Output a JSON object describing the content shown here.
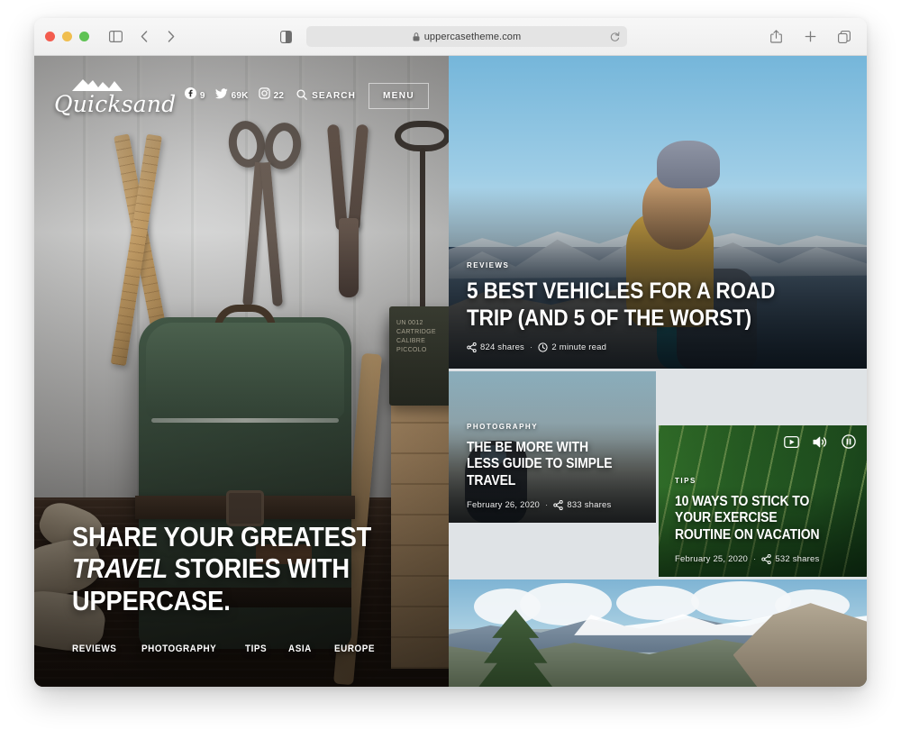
{
  "browser": {
    "url": "uppercasetheme.com",
    "lock_icon": "lock-icon",
    "reload_icon": "reload-icon",
    "sidebar_icon": "sidebar-toggle-icon",
    "back_icon": "back-chevron-icon",
    "forward_icon": "forward-chevron-icon",
    "reader_icon": "reader-appearance-icon",
    "share_icon": "share-icon",
    "newtab_icon": "plus-icon",
    "tabs_icon": "tab-overview-icon",
    "traffic_lights": [
      "close",
      "minimize",
      "zoom"
    ]
  },
  "hero": {
    "brand": "Quicksand",
    "brand_mark": "mountain-icon",
    "social": [
      {
        "network": "facebook",
        "icon": "facebook-icon",
        "count": "9"
      },
      {
        "network": "twitter",
        "icon": "twitter-icon",
        "count": "69K"
      },
      {
        "network": "instagram",
        "icon": "instagram-icon",
        "count": "22"
      }
    ],
    "search_label": "SEARCH",
    "search_icon": "search-icon",
    "menu_label": "MENU",
    "title_line1": "SHARE YOUR GREATEST",
    "title_em": "TRAVEL",
    "title_line2_rest": " STORIES WITH",
    "title_line3": "UPPERCASE.",
    "categories": [
      "REVIEWS",
      "PHOTOGRAPHY",
      "TIPS",
      "ASIA",
      "EUROPE"
    ]
  },
  "cards": {
    "road": {
      "kicker": "REVIEWS",
      "title": "5 BEST VEHICLES FOR A ROAD TRIP (AND 5 OF THE WORST)",
      "shares": "824 shares",
      "read_time": "2 minute read",
      "share_icon": "share-nodes-icon",
      "clock_icon": "clock-icon",
      "separator": "·"
    },
    "photography": {
      "kicker": "PHOTOGRAPHY",
      "title": "THE BE MORE WITH LESS GUIDE TO SIMPLE TRAVEL",
      "date": "February 26, 2020",
      "shares": "833 shares",
      "share_icon": "share-nodes-icon",
      "separator": "·"
    },
    "tips": {
      "kicker": "TIPS",
      "title": "10 WAYS TO STICK TO YOUR EXERCISE ROUTINE ON VACATION",
      "date": "February 25, 2020",
      "shares": "532 shares",
      "share_icon": "share-nodes-icon",
      "separator": "·",
      "video_controls": [
        {
          "name": "play-icon",
          "label": "play"
        },
        {
          "name": "volume-icon",
          "label": "volume"
        },
        {
          "name": "pause-icon",
          "label": "pause"
        }
      ]
    },
    "mountains": {
      "alt": "mountain valley panorama"
    }
  },
  "colors": {
    "page_bg": "#ffffff",
    "toolbar_bg": "#f2f2f2",
    "url_bar_bg": "#e4e4e4",
    "text_on_image": "#ffffff",
    "tips_green": "#2f6f2a",
    "traffic_red": "#f35c4e",
    "traffic_yellow": "#f0be4f",
    "traffic_green": "#5fc254"
  }
}
